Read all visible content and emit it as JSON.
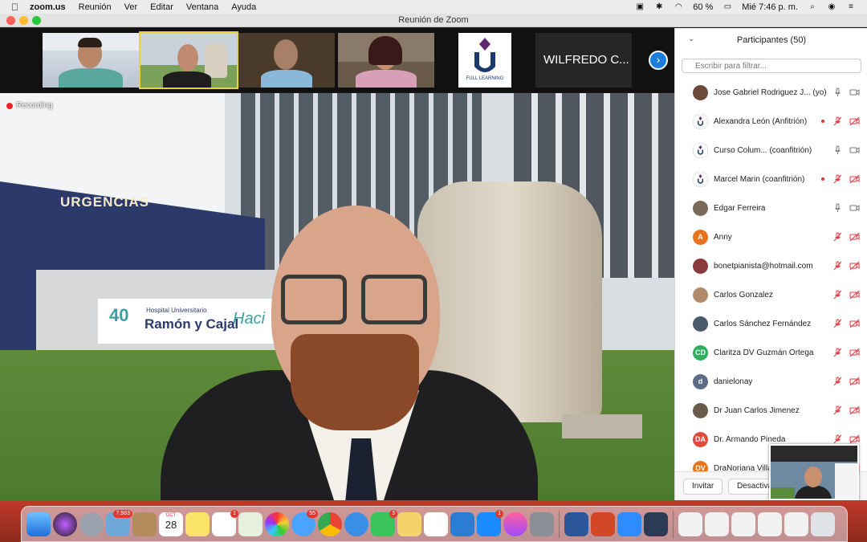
{
  "menubar": {
    "app_name": "zoom.us",
    "menus": [
      "Reunión",
      "Ver",
      "Editar",
      "Ventana",
      "Ayuda"
    ],
    "battery": "60 %",
    "clock": "Mié 7:46 p. m."
  },
  "window": {
    "title": "Reunión de Zoom"
  },
  "gallery": {
    "name_tile": "WILFREDO C...",
    "logo_text": "FULL LEARNING"
  },
  "main_video": {
    "recording_label": "Recording",
    "sign_urgencias": "URGENCIAS",
    "sign_number": "40",
    "sign_hospital_small": "Hospital Universitario",
    "sign_hospital_big": "Ramón y Cajal",
    "sign_hacia": "Haci"
  },
  "participants": {
    "header": "Participantes (50)",
    "filter_placeholder": "Escribir para filtrar...",
    "list": [
      {
        "name": "Jose Gabriel Rodriguez J...  (yo)",
        "avatar": "photo",
        "avatar_color": "#6b4a3a",
        "initials": "",
        "hand": false,
        "mic": "on",
        "cam": "on"
      },
      {
        "name": "Alexandra León (Anfitrión)",
        "avatar": "logo",
        "avatar_color": "#1d3a6e",
        "initials": "",
        "hand": true,
        "mic": "off",
        "cam": "off"
      },
      {
        "name": "Curso Colum...  (coanfitrión)",
        "avatar": "logo",
        "avatar_color": "#1d3a6e",
        "initials": "",
        "hand": false,
        "mic": "on",
        "cam": "on"
      },
      {
        "name": "Marcel Marin (coanfitrión)",
        "avatar": "logo",
        "avatar_color": "#1d3a6e",
        "initials": "",
        "hand": true,
        "mic": "off",
        "cam": "off"
      },
      {
        "name": "Edgar Ferreira",
        "avatar": "photo",
        "avatar_color": "#7a6a5a",
        "initials": "",
        "hand": false,
        "mic": "on",
        "cam": "on"
      },
      {
        "name": "Anny",
        "avatar": "initial",
        "avatar_color": "#e8731c",
        "initials": "A",
        "hand": false,
        "mic": "off",
        "cam": "off"
      },
      {
        "name": "bonetpianista@hotmail.com",
        "avatar": "photo",
        "avatar_color": "#8a3a3a",
        "initials": "",
        "hand": false,
        "mic": "off",
        "cam": "off"
      },
      {
        "name": "Carlos Gonzalez",
        "avatar": "photo",
        "avatar_color": "#b08a6a",
        "initials": "",
        "hand": false,
        "mic": "off",
        "cam": "off"
      },
      {
        "name": "Carlos Sánchez Fernández",
        "avatar": "photo",
        "avatar_color": "#4a5a6a",
        "initials": "",
        "hand": false,
        "mic": "off",
        "cam": "off"
      },
      {
        "name": "Claritza DV Guzmán Ortega",
        "avatar": "initial",
        "avatar_color": "#2fae5b",
        "initials": "CD",
        "hand": false,
        "mic": "off",
        "cam": "off"
      },
      {
        "name": "danielonay",
        "avatar": "initial",
        "avatar_color": "#5d6b86",
        "initials": "d",
        "hand": false,
        "mic": "off",
        "cam": "off"
      },
      {
        "name": "Dr Juan Carlos Jimenez",
        "avatar": "photo",
        "avatar_color": "#6a5a4a",
        "initials": "",
        "hand": false,
        "mic": "off",
        "cam": "off"
      },
      {
        "name": "Dr. Armando Pineda",
        "avatar": "initial",
        "avatar_color": "#e04a3a",
        "initials": "DA",
        "hand": false,
        "mic": "off",
        "cam": "off"
      },
      {
        "name": "DraNoriana Villa",
        "avatar": "initial",
        "avatar_color": "#e8731c",
        "initials": "DV",
        "hand": false,
        "mic": "off",
        "cam": "off"
      }
    ],
    "invite_label": "Invitar",
    "mute_label": "Desactivar"
  },
  "dock": {
    "calendar_month": "OCT",
    "calendar_day": "28",
    "badges": {
      "photos": "7.983",
      "reminders": "1",
      "messages": "55",
      "facetime": "3",
      "appstore": "1"
    }
  },
  "colors": {
    "accent_blue": "#1b7fe0",
    "muted_red": "#e0393e",
    "active_speaker": "#e6d33a"
  }
}
